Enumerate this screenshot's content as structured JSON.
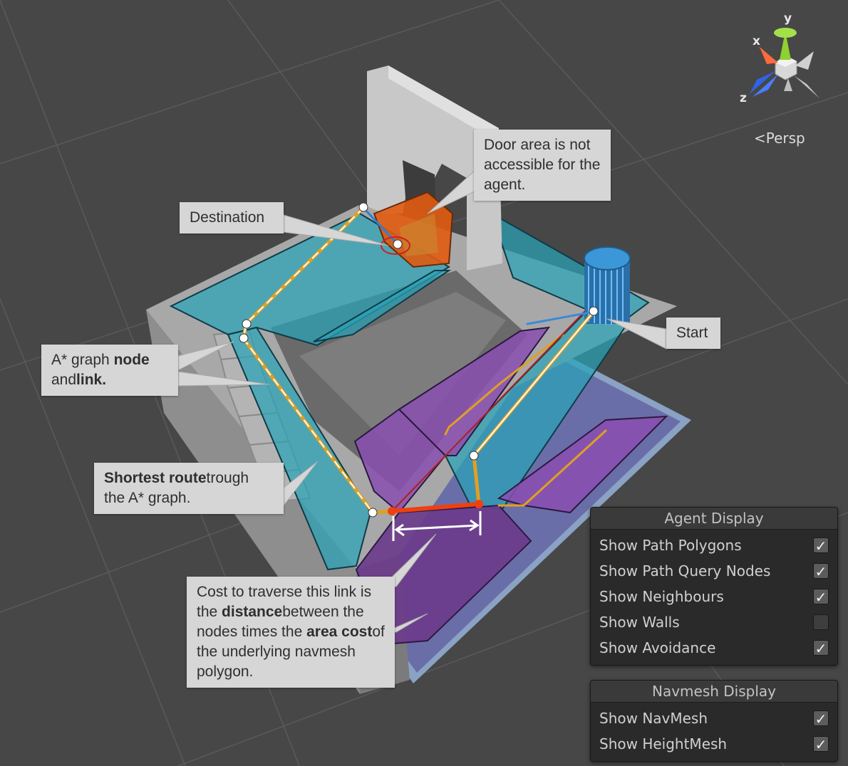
{
  "gizmo": {
    "x_label": "x",
    "y_label": "y",
    "z_label": "z",
    "projection_label": "Persp",
    "projection_icon": "perspective-arrow-icon",
    "colors": {
      "x": "#e8431f",
      "y": "#8fd12f",
      "z": "#2f63e8"
    }
  },
  "callouts": {
    "door": "Door area is not accessible for the agent.",
    "destination": "Destination",
    "start": "Start",
    "graph_node_link": [
      "A* graph ",
      "node",
      " and",
      "link."
    ],
    "shortest_route": [
      "Shortest route",
      "trough the A* graph."
    ],
    "cost": [
      "Cost to traverse this link is the ",
      "distance",
      "between the nodes times the ",
      "area cost",
      "of the underlying navmesh polygon."
    ]
  },
  "agent_display": {
    "title": "Agent Display",
    "options": [
      {
        "label": "Show Path Polygons",
        "checked": true
      },
      {
        "label": "Show Path Query Nodes",
        "checked": true
      },
      {
        "label": "Show Neighbours",
        "checked": true
      },
      {
        "label": "Show Walls",
        "checked": false
      },
      {
        "label": "Show Avoidance",
        "checked": true
      }
    ]
  },
  "navmesh_display": {
    "title": "Navmesh Display",
    "options": [
      {
        "label": "Show NavMesh",
        "checked": true
      },
      {
        "label": "Show HeightMesh",
        "checked": true
      }
    ]
  },
  "colors": {
    "background": "#474747",
    "navmesh_walkable": "#2aa3b8",
    "navmesh_area_cost": "#8a4fb0",
    "path_line": "#e0a020",
    "path_link_highlight": "#f04010",
    "door_area": "#e05a10",
    "agent": "#2e8fcc"
  }
}
